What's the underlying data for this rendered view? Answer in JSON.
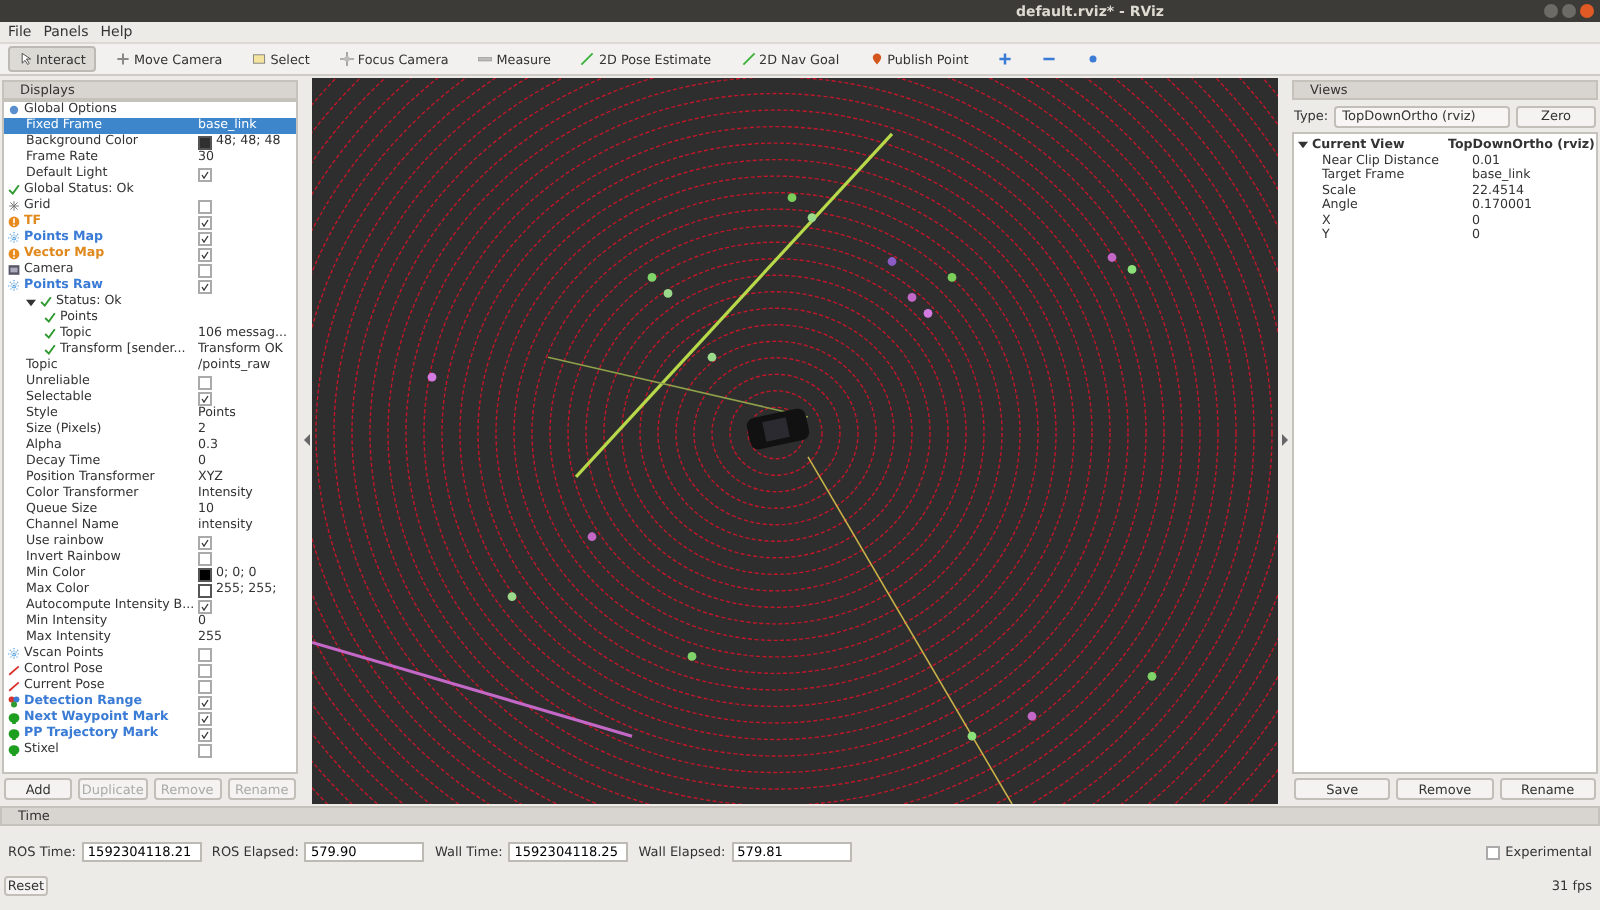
{
  "window": {
    "title": "default.rviz* - RViz"
  },
  "menu": [
    "File",
    "Panels",
    "Help"
  ],
  "toolbar": [
    {
      "kind": "interact",
      "label": "Interact",
      "selected": true
    },
    {
      "kind": "move",
      "label": "Move Camera",
      "selected": false
    },
    {
      "kind": "select",
      "label": "Select",
      "selected": false
    },
    {
      "kind": "focus",
      "label": "Focus Camera",
      "selected": false
    },
    {
      "kind": "measure",
      "label": "Measure",
      "selected": false
    },
    {
      "kind": "pose",
      "label": "2D Pose Estimate",
      "selected": false
    },
    {
      "kind": "goal",
      "label": "2D Nav Goal",
      "selected": false
    },
    {
      "kind": "point",
      "label": "Publish Point",
      "selected": false
    },
    {
      "kind": "add",
      "selected": false
    },
    {
      "kind": "remove",
      "selected": false
    },
    {
      "kind": "camera",
      "selected": false
    }
  ],
  "displays": {
    "title": "Displays",
    "items": [
      {
        "kind": "options",
        "name": "Global Options",
        "selected": false,
        "children": [
          {
            "kind": "property",
            "name": "Fixed Frame",
            "value": "base_link",
            "selected": true
          },
          {
            "kind": "property",
            "name": "Background Color",
            "value": "48; 48; 48",
            "color": "#303030",
            "selected": false
          },
          {
            "kind": "property",
            "name": "Frame Rate",
            "value": "30",
            "selected": false
          },
          {
            "kind": "property",
            "name": "Default Light",
            "checked": true,
            "selected": false
          }
        ]
      },
      {
        "kind": "ok",
        "name": "Global Status: Ok",
        "selected": false
      },
      {
        "kind": "grid",
        "name": "Grid",
        "checked": false,
        "selected": false
      },
      {
        "kind": "warning",
        "name": "TF",
        "checked": true,
        "warning": true,
        "selected": false
      },
      {
        "kind": "cloud",
        "name": "Points Map",
        "checked": true,
        "highlighted": true,
        "selected": false
      },
      {
        "kind": "warning",
        "name": "Vector Map",
        "checked": true,
        "warning": true,
        "selected": false
      },
      {
        "kind": "camera",
        "name": "Camera",
        "checked": false,
        "selected": false
      },
      {
        "kind": "cloud",
        "name": "Points Raw",
        "checked": true,
        "highlighted": true,
        "selected": false,
        "children": [
          {
            "kind": "ok",
            "name": "Status: Ok",
            "expanded": true,
            "selected": false,
            "children": [
              {
                "kind": "ok",
                "name": "Points",
                "selected": false
              },
              {
                "kind": "ok",
                "name": "Topic",
                "value": "106 messag...",
                "selected": false
              },
              {
                "kind": "ok",
                "name": "Transform [sender...",
                "value": "Transform OK",
                "selected": false
              }
            ]
          },
          {
            "kind": "property",
            "name": "Topic",
            "value": "/points_raw",
            "selected": false
          },
          {
            "kind": "property",
            "name": "Unreliable",
            "checked": false,
            "selected": false
          },
          {
            "kind": "property",
            "name": "Selectable",
            "checked": true,
            "selected": false
          },
          {
            "kind": "property",
            "name": "Style",
            "value": "Points",
            "selected": false
          },
          {
            "kind": "property",
            "name": "Size (Pixels)",
            "value": "2",
            "selected": false
          },
          {
            "kind": "property",
            "name": "Alpha",
            "value": "0.3",
            "selected": false
          },
          {
            "kind": "property",
            "name": "Decay Time",
            "value": "0",
            "selected": false
          },
          {
            "kind": "property",
            "name": "Position Transformer",
            "value": "XYZ",
            "selected": false
          },
          {
            "kind": "property",
            "name": "Color Transformer",
            "value": "Intensity",
            "selected": false
          },
          {
            "kind": "property",
            "name": "Queue Size",
            "value": "10",
            "selected": false
          },
          {
            "kind": "property",
            "name": "Channel Name",
            "value": "intensity",
            "selected": false
          },
          {
            "kind": "property",
            "name": "Use rainbow",
            "checked": true,
            "selected": false
          },
          {
            "kind": "property",
            "name": "Invert Rainbow",
            "checked": false,
            "selected": false
          },
          {
            "kind": "property",
            "name": "Min Color",
            "value": "0; 0; 0",
            "color": "#000000",
            "selected": false
          },
          {
            "kind": "property",
            "name": "Max Color",
            "value": "255; 255;",
            "color": "#ffffff",
            "selected": false
          },
          {
            "kind": "property",
            "name": "Autocompute Intensity B...",
            "checked": true,
            "selected": false
          },
          {
            "kind": "property",
            "name": "Min Intensity",
            "value": "0",
            "selected": false
          },
          {
            "kind": "property",
            "name": "Max Intensity",
            "value": "255",
            "selected": false
          }
        ]
      },
      {
        "kind": "cloud",
        "name": "Vscan Points",
        "checked": false,
        "selected": false
      },
      {
        "kind": "pose",
        "name": "Control Pose",
        "checked": false,
        "selected": false
      },
      {
        "kind": "pose",
        "name": "Current Pose",
        "checked": false,
        "selected": false
      },
      {
        "kind": "range",
        "name": "Detection Range",
        "checked": true,
        "highlighted": true,
        "selected": false
      },
      {
        "kind": "marker",
        "name": "Next Waypoint Mark",
        "checked": true,
        "highlighted": true,
        "selected": false
      },
      {
        "kind": "marker",
        "name": "PP Trajectory Mark",
        "checked": true,
        "highlighted": true,
        "selected": false
      },
      {
        "kind": "marker",
        "name": "Stixel",
        "checked": false,
        "highlighted": false,
        "selected": false
      }
    ],
    "buttons": [
      {
        "label": "Add",
        "disabled": false
      },
      {
        "label": "Duplicate",
        "disabled": true
      },
      {
        "label": "Remove",
        "disabled": true
      },
      {
        "label": "Rename",
        "disabled": true
      }
    ]
  },
  "views": {
    "title": "Views",
    "type_label": "Type:",
    "type_value": "TopDownOrtho (rviz)",
    "zero": "Zero",
    "current": {
      "name": "Current View",
      "value": "TopDownOrtho (rviz)",
      "expanded": true,
      "children": [
        {
          "name": "Near Clip Distance",
          "value": "0.01"
        },
        {
          "name": "Target Frame",
          "value": "base_link"
        },
        {
          "name": "Scale",
          "value": "22.4514"
        },
        {
          "name": "Angle",
          "value": "0.170001"
        },
        {
          "name": "X",
          "value": "0"
        },
        {
          "name": "Y",
          "value": "0"
        }
      ]
    },
    "buttons": [
      "Save",
      "Remove",
      "Rename"
    ]
  },
  "time": {
    "title": "Time",
    "fields": [
      {
        "label": "ROS Time:",
        "value": "1592304118.21"
      },
      {
        "label": "ROS Elapsed:",
        "value": "579.90"
      },
      {
        "label": "Wall Time:",
        "value": "1592304118.25"
      },
      {
        "label": "Wall Elapsed:",
        "value": "579.81"
      }
    ],
    "experimental": {
      "label": "Experimental",
      "checked": false
    },
    "reset": "Reset",
    "fps": "31 fps"
  }
}
